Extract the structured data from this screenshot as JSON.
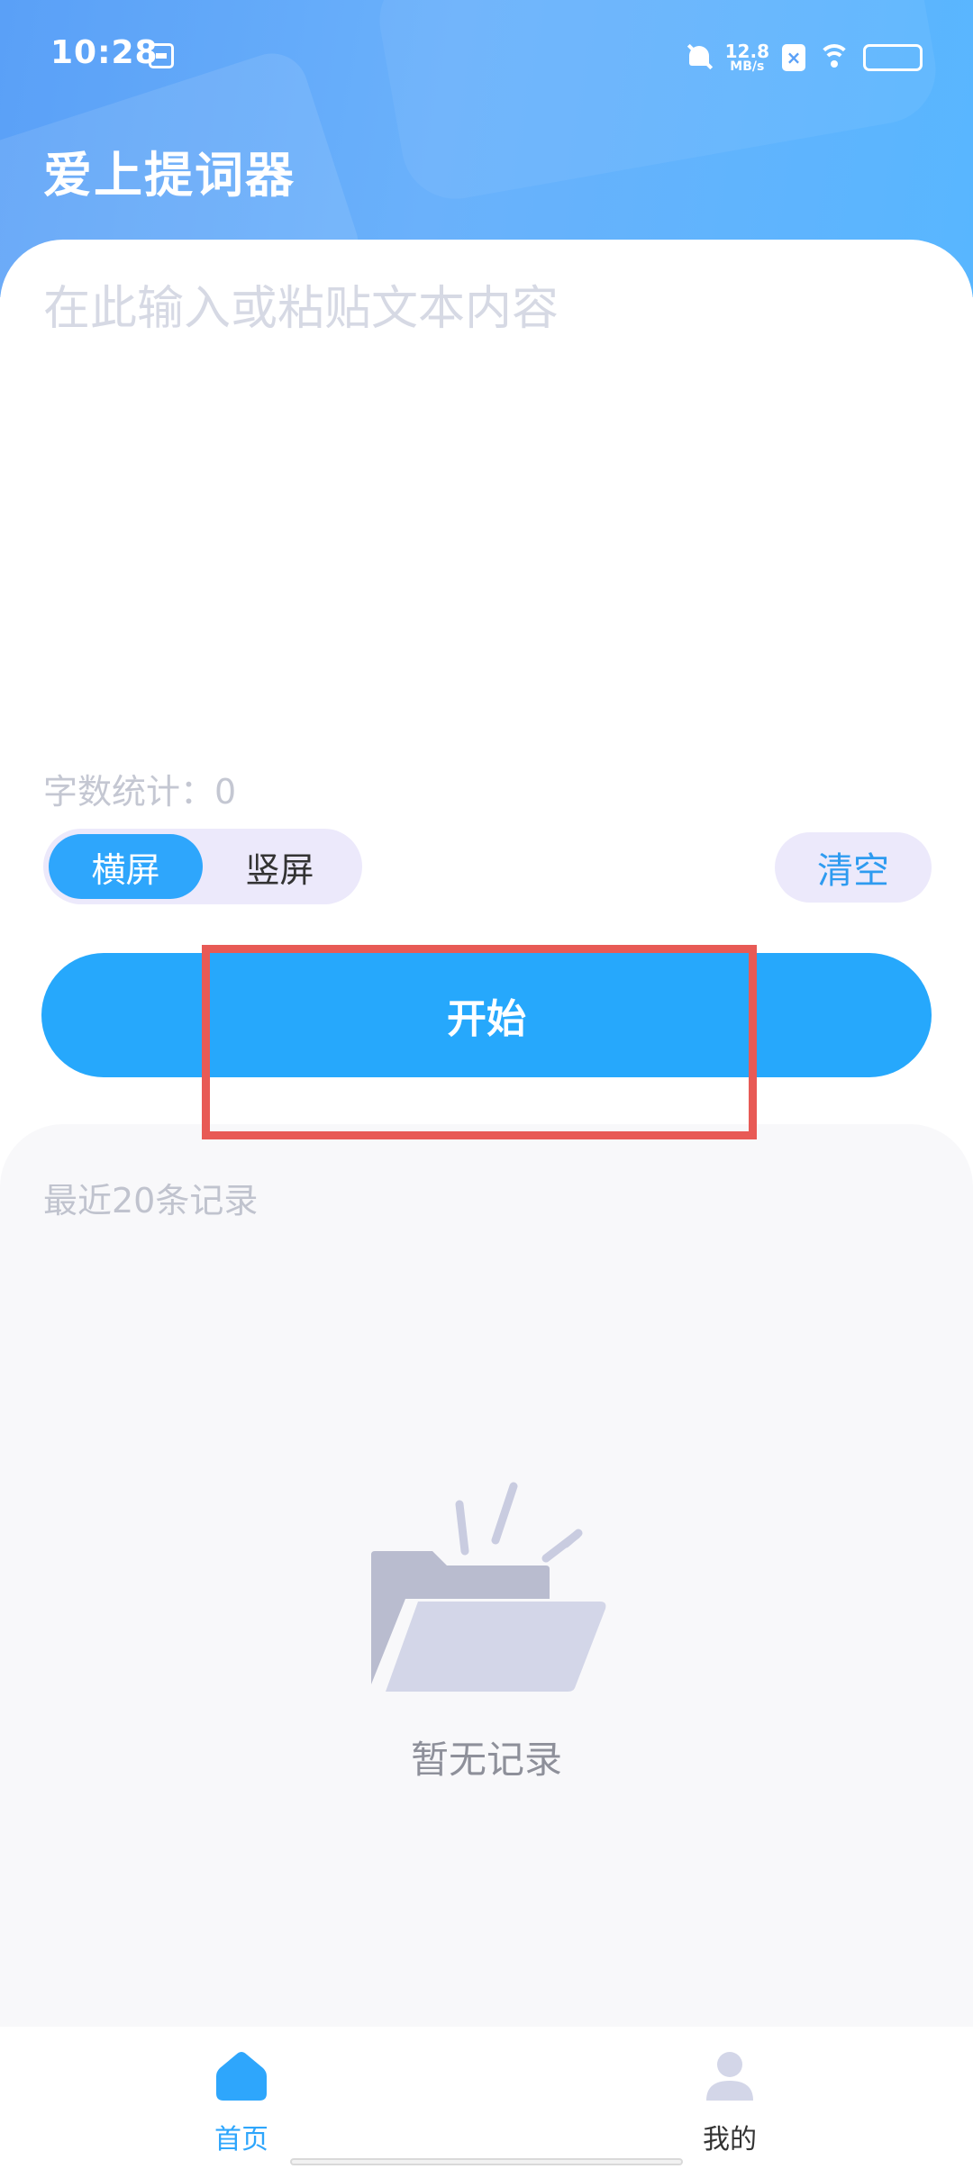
{
  "status_bar": {
    "time": "10:28",
    "net_speed_value": "12.8",
    "net_speed_unit": "MB/s",
    "x_badge": "×",
    "icons": [
      "calendar-icon",
      "bell-muted-icon",
      "x-badge-icon",
      "wifi-icon",
      "battery-icon"
    ]
  },
  "header": {
    "title": "爱上提词器"
  },
  "editor": {
    "placeholder": "在此输入或粘贴文本内容",
    "value": "",
    "word_count_label": "字数统计：0"
  },
  "orientation": {
    "options": [
      "横屏",
      "竖屏"
    ],
    "selected": "横屏"
  },
  "clear_label": "清空",
  "start_label": "开始",
  "records": {
    "title": "最近20条记录",
    "empty_text": "暂无记录"
  },
  "bottom_nav": {
    "items": [
      {
        "label": "首页",
        "icon": "home-icon",
        "active": true
      },
      {
        "label": "我的",
        "icon": "user-icon",
        "active": false
      }
    ]
  },
  "colors": {
    "accent": "#26a8fc",
    "highlight": "#e85a55",
    "header_gradient_start": "#5aa0f7",
    "header_gradient_end": "#58b6ff"
  }
}
